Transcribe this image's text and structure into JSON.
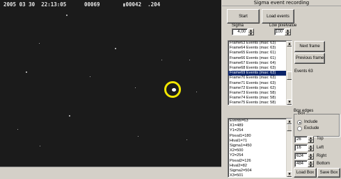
{
  "video": {
    "osd_date": "2005 03 30",
    "osd_time": "22:13:05",
    "osd_frame": "00069",
    "osd_field": "00042",
    "osd_ms": ".204"
  },
  "panel": {
    "title": "Sigma event recording",
    "start_label": "Start",
    "load_events_label": "Load events",
    "sigma_label": "Sigma",
    "sigma_value": "4,00",
    "low_pixelvalue_label": "Low pixelvalue",
    "low_pixelvalue_value": "100",
    "next_frame_label": "Next frame",
    "previous_frame_label": "Previous frame",
    "events_count_label": "Events 63",
    "frames": [
      "Frame63 Events (max: 63)",
      "Frame64 Events (max: 63)",
      "Frame65 Events (max: 61)",
      "Frame66 Events (max: 61)",
      "Frame67 Events (max: 64)",
      "Frame68 Events (max: 63)",
      "Frame69 Events (max: 63)",
      "Frame70 Events (max: 63)",
      "Frame71 Events (max: 63)",
      "Frame72 Events (max: 62)",
      "Frame73 Events (max: 58)",
      "Frame74 Events (max: 58)",
      "Frame75 Events (max: 58)"
    ],
    "details": [
      "Events=63",
      "X1=489",
      "Y1=254",
      "Pixval1=180",
      "Hival1=71",
      "Sigma1=450",
      "X2=500",
      "Y2=254",
      "Pixval2=126",
      "Hival2=82",
      "Sigma2=504",
      "X3=501"
    ],
    "box_edges_label": "Box edges",
    "box_label": "Box",
    "include_label": "Include",
    "exclude_label": "Exclude",
    "top_value": "26",
    "top_label": "Top",
    "left_value": "16",
    "left_label": "Left",
    "right_value": "624",
    "right_label": "Right",
    "bottom_value": "484",
    "bottom_label": "Bottom",
    "load_box_label": "Load Box",
    "save_box_label": "Save Box"
  }
}
